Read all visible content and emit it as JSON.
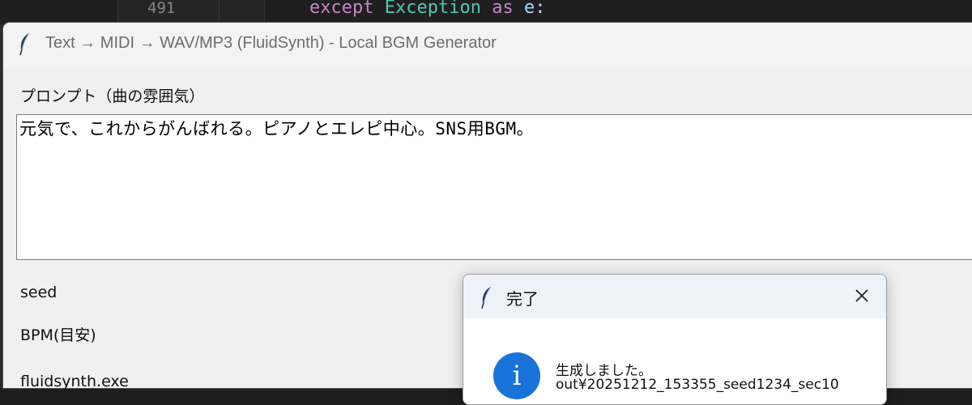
{
  "editor": {
    "line_number": "491",
    "code": {
      "kw1": "except",
      "cls": "Exception",
      "kw2": "as",
      "var": "e",
      "punc": ":"
    }
  },
  "window": {
    "title": "Text → MIDI → WAV/MP3 (FluidSynth) - Local BGM Generator",
    "icon": "feather-icon"
  },
  "prompt": {
    "label": "プロンプト（曲の雰囲気）",
    "value": "元気で、これからがんばれる。ピアノとエレピ中心。SNS用BGM。"
  },
  "fields": {
    "seed_label": "seed",
    "bpm_label": "BPM(目安)",
    "fluidsynth_label": "fluidsynth.exe"
  },
  "dialog": {
    "title": "完了",
    "icon": "info-icon",
    "close_icon": "close-icon",
    "message_line1": "生成しました。",
    "message_line2": "out¥20251212_153355_seed1234_sec10",
    "colors": {
      "info_blue": "#1a73d9",
      "titlebar": "#eef3fa"
    }
  }
}
